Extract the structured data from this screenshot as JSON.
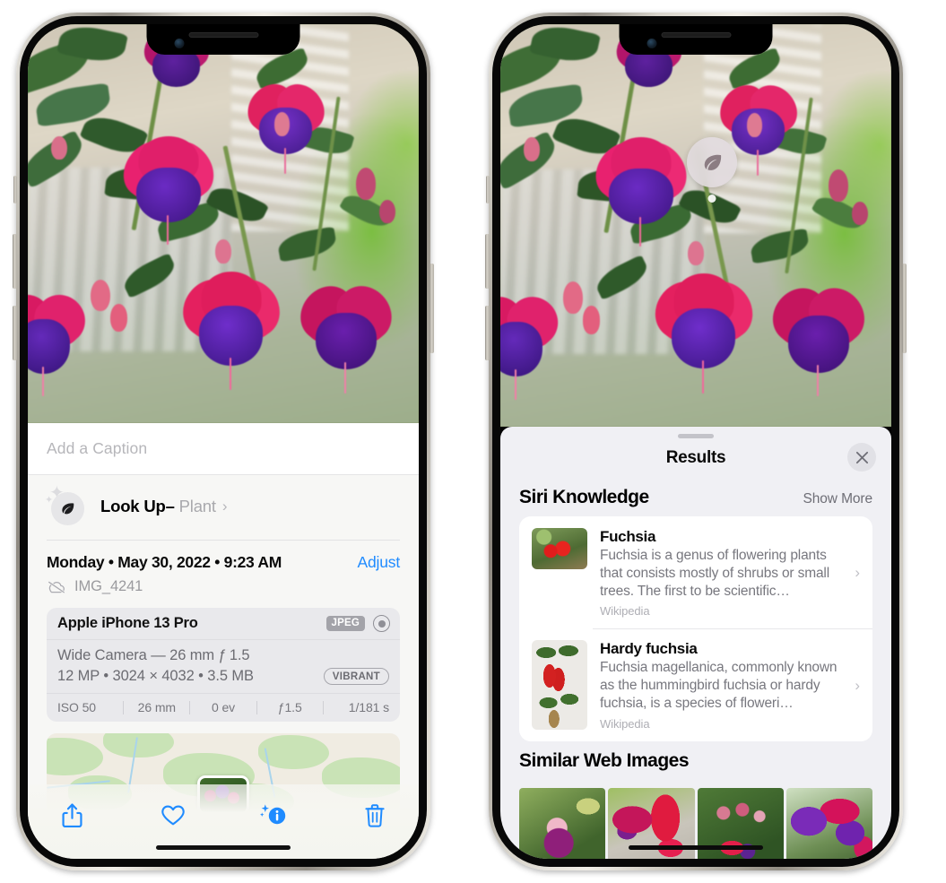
{
  "left_phone": {
    "photo": {
      "alt_name": "fuchsia-flowers-photo"
    },
    "caption": {
      "placeholder": "Add a Caption",
      "value": ""
    },
    "look_up": {
      "label": "Look Up",
      "dash": "–",
      "subject": "Plant",
      "chevron": "›",
      "icon": "leaf-icon"
    },
    "metadata": {
      "date_line": "Monday • May 30, 2022 • 9:23 AM",
      "adjust_label": "Adjust",
      "filename": "IMG_4241",
      "cloud_icon": "icloud-slash-icon"
    },
    "camera_card": {
      "device": "Apple iPhone 13 Pro",
      "format_tag": "JPEG",
      "lens_icon": "aperture-icon",
      "lens_line": "Wide Camera — 26 mm ƒ 1.5",
      "specs_line": "12 MP • 3024 × 4032 • 3.5 MB",
      "style_tag": "VIBRANT",
      "exif": [
        "ISO 50",
        "26 mm",
        "0 ev",
        "ƒ1.5",
        "1/181 s"
      ]
    },
    "toolbar": [
      {
        "name": "share-button",
        "label": "Share"
      },
      {
        "name": "favorite-button",
        "label": "Favorite"
      },
      {
        "name": "info-button",
        "label": "Info"
      },
      {
        "name": "delete-button",
        "label": "Delete"
      }
    ]
  },
  "right_phone": {
    "badge": {
      "icon": "leaf-icon",
      "name": "visual-look-up-badge"
    },
    "results": {
      "title": "Results",
      "close_label": "×",
      "sections": [
        {
          "title": "Siri Knowledge",
          "action": "Show More",
          "items": [
            {
              "title": "Fuchsia",
              "description": "Fuchsia is a genus of flowering plants that consists mostly of shrubs or small trees. The first to be scientific…",
              "source": "Wikipedia"
            },
            {
              "title": "Hardy fuchsia",
              "description": "Fuchsia magellanica, commonly known as the hummingbird fuchsia or hardy fuchsia, is a species of floweri…",
              "source": "Wikipedia"
            }
          ]
        },
        {
          "title": "Similar Web Images",
          "action": "",
          "images": [
            {
              "name": "similar-web-image-1"
            },
            {
              "name": "similar-web-image-2"
            },
            {
              "name": "similar-web-image-3"
            },
            {
              "name": "similar-web-image-4"
            }
          ]
        }
      ]
    }
  },
  "colors": {
    "accent_blue": "#1f8bff",
    "sheet_background": "#f0f0f4",
    "card_background": "#ffffff",
    "secondary_text": "#77777e",
    "tag_gray": "#a3a3a9"
  }
}
